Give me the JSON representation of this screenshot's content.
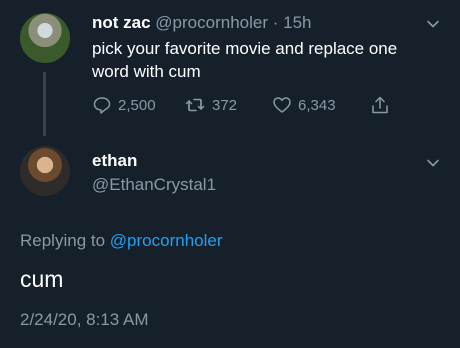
{
  "colors": {
    "background": "#15202b",
    "text_primary": "#ffffff",
    "text_secondary": "#8899a6",
    "link": "#1da1f2",
    "thread_line": "#38444d"
  },
  "parent_tweet": {
    "display_name": "not zac",
    "handle": "@procornholer",
    "separator": "·",
    "time": "15h",
    "text": "pick your favorite movie and replace one word with cum",
    "actions": {
      "reply_count": "2,500",
      "retweet_count": "372",
      "like_count": "6,343"
    },
    "icons": {
      "reply": "reply-icon",
      "retweet": "retweet-icon",
      "like": "heart-icon",
      "share": "share-icon",
      "menu": "chevron-down-icon"
    }
  },
  "reply_tweet": {
    "display_name": "ethan",
    "handle": "@EthanCrystal1",
    "replying_prefix": "Replying to",
    "replying_to": "@procornholer",
    "text": "cum",
    "timestamp": "2/24/20, 8:13 AM",
    "icons": {
      "menu": "chevron-down-icon"
    }
  }
}
